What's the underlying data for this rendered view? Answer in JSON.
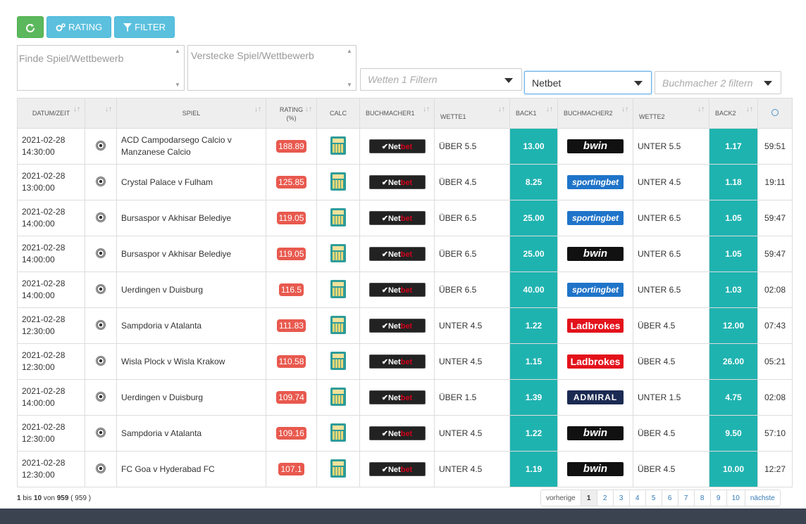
{
  "toolbar": {
    "rating_label": "RATING",
    "filter_label": "FILTER"
  },
  "filters": {
    "find_placeholder": "Finde Spiel/Wettbewerb",
    "hide_placeholder": "Verstecke Spiel/Wettbewerb",
    "bets_placeholder": "Wetten 1 Filtern",
    "bookmaker1_value": "Netbet",
    "bookmaker2_placeholder": "Buchmacher 2 filtern"
  },
  "table": {
    "headers": {
      "date": "DATUM/ZEIT",
      "game": "SPIEL",
      "rating": "RATING",
      "rating_unit": "(%)",
      "calc": "CALC",
      "bookmaker1": "BUCHMACHER1",
      "bet1": "WETTE1",
      "back1": "BACK1",
      "bookmaker2": "BUCHMACHER2",
      "bet2": "WETTE2",
      "back2": "BACK2"
    },
    "rows": [
      {
        "date": "2021-02-28",
        "time": "14:30:00",
        "game1": "ACD Campodarsego Calcio v",
        "game2": "Manzanese Calcio",
        "rating": "188.89",
        "bm1": "netbet",
        "bet1": "ÜBER 5.5",
        "back1": "13.00",
        "bm2": "bwin",
        "bet2": "UNTER 5.5",
        "back2": "1.17",
        "timer": "59:51"
      },
      {
        "date": "2021-02-28",
        "time": "13:00:00",
        "game1": "Crystal Palace v Fulham",
        "game2": "",
        "rating": "125.85",
        "bm1": "netbet",
        "bet1": "ÜBER 4.5",
        "back1": "8.25",
        "bm2": "sportingbet",
        "bet2": "UNTER 4.5",
        "back2": "1.18",
        "timer": "19:11"
      },
      {
        "date": "2021-02-28",
        "time": "14:00:00",
        "game1": "Bursaspor v Akhisar Belediye",
        "game2": "",
        "rating": "119.05",
        "bm1": "netbet",
        "bet1": "ÜBER 6.5",
        "back1": "25.00",
        "bm2": "sportingbet",
        "bet2": "UNTER 6.5",
        "back2": "1.05",
        "timer": "59:47"
      },
      {
        "date": "2021-02-28",
        "time": "14:00:00",
        "game1": "Bursaspor v Akhisar Belediye",
        "game2": "",
        "rating": "119.05",
        "bm1": "netbet",
        "bet1": "ÜBER 6.5",
        "back1": "25.00",
        "bm2": "bwin",
        "bet2": "UNTER 6.5",
        "back2": "1.05",
        "timer": "59:47"
      },
      {
        "date": "2021-02-28",
        "time": "14:00:00",
        "game1": "Uerdingen v Duisburg",
        "game2": "",
        "rating": "116.5",
        "bm1": "netbet",
        "bet1": "ÜBER 6.5",
        "back1": "40.00",
        "bm2": "sportingbet",
        "bet2": "UNTER 6.5",
        "back2": "1.03",
        "timer": "02:08"
      },
      {
        "date": "2021-02-28",
        "time": "12:30:00",
        "game1": "Sampdoria v Atalanta",
        "game2": "",
        "rating": "111.83",
        "bm1": "netbet",
        "bet1": "UNTER 4.5",
        "back1": "1.22",
        "bm2": "ladbrokes",
        "bet2": "ÜBER 4.5",
        "back2": "12.00",
        "timer": "07:43"
      },
      {
        "date": "2021-02-28",
        "time": "12:30:00",
        "game1": "Wisla Plock v Wisla Krakow",
        "game2": "",
        "rating": "110.58",
        "bm1": "netbet",
        "bet1": "UNTER 4.5",
        "back1": "1.15",
        "bm2": "ladbrokes",
        "bet2": "ÜBER 4.5",
        "back2": "26.00",
        "timer": "05:21"
      },
      {
        "date": "2021-02-28",
        "time": "14:00:00",
        "game1": "Uerdingen v Duisburg",
        "game2": "",
        "rating": "109.74",
        "bm1": "netbet",
        "bet1": "ÜBER 1.5",
        "back1": "1.39",
        "bm2": "admiral",
        "bet2": "UNTER 1.5",
        "back2": "4.75",
        "timer": "02:08"
      },
      {
        "date": "2021-02-28",
        "time": "12:30:00",
        "game1": "Sampdoria v Atalanta",
        "game2": "",
        "rating": "109.16",
        "bm1": "netbet",
        "bet1": "UNTER 4.5",
        "back1": "1.22",
        "bm2": "bwin",
        "bet2": "ÜBER 4.5",
        "back2": "9.50",
        "timer": "57:10"
      },
      {
        "date": "2021-02-28",
        "time": "12:30:00",
        "game1": "FC Goa v Hyderabad FC",
        "game2": "",
        "rating": "107.1",
        "bm1": "netbet",
        "bet1": "UNTER 4.5",
        "back1": "1.19",
        "bm2": "bwin",
        "bet2": "ÜBER 4.5",
        "back2": "10.00",
        "timer": "12:27"
      }
    ]
  },
  "logos": {
    "netbet_a": "Net",
    "netbet_b": "bet",
    "bwin": "bwin",
    "sportingbet": "sportingbet",
    "ladbrokes": "Ladbrokes",
    "admiral": "ADMIRAL"
  },
  "info": {
    "from": "1",
    "word_to": "bis",
    "to": "10",
    "word_of": "von",
    "total": "959",
    "total_paren": "( 959 )"
  },
  "pagination": {
    "prev": "vorherige",
    "pages": [
      "1",
      "2",
      "3",
      "4",
      "5",
      "6",
      "7",
      "8",
      "9",
      "10"
    ],
    "next": "nächste",
    "current": "1"
  },
  "colors": {
    "teal": "#1fb3b0",
    "rating_red": "#e8594e",
    "green_btn": "#5cb85c",
    "blue_btn": "#5bc0de"
  }
}
